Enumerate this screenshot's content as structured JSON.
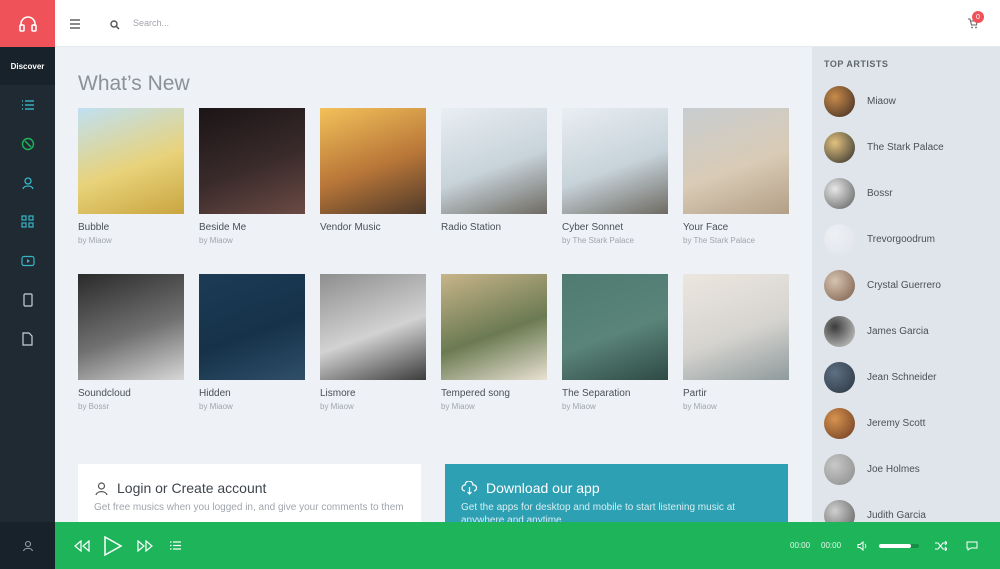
{
  "nav": {
    "discover_label": "Discover"
  },
  "search": {
    "placeholder": "Search..."
  },
  "cart": {
    "count": "0"
  },
  "main": {
    "heading": "What’s New",
    "albums": [
      {
        "title": "Bubble",
        "artist": "by Miaow",
        "palette": [
          "#bfe0f2",
          "#e8d27a",
          "#c9a53f"
        ]
      },
      {
        "title": "Beside Me",
        "artist": "by Miaow",
        "palette": [
          "#1b1416",
          "#3a2b2b",
          "#6b4a44"
        ]
      },
      {
        "title": "Vendor Music",
        "artist": "",
        "palette": [
          "#f3c15a",
          "#b87638",
          "#4f3a2a"
        ]
      },
      {
        "title": "Radio Station",
        "artist": "",
        "palette": [
          "#e9eef2",
          "#c7d3da",
          "#6e6a62"
        ]
      },
      {
        "title": "Cyber Sonnet",
        "artist": "by The Stark Palace",
        "palette": [
          "#e9eef2",
          "#c7d3da",
          "#6e6a62"
        ]
      },
      {
        "title": "Your Face",
        "artist": "by The Stark Palace",
        "palette": [
          "#c8ccd0",
          "#d9cbb6",
          "#b39f86"
        ]
      },
      {
        "title": "Soundcloud",
        "artist": "by Bossr",
        "palette": [
          "#2a2a2a",
          "#707070",
          "#d8d8d8"
        ]
      },
      {
        "title": "Hidden",
        "artist": "by Miaow",
        "palette": [
          "#1c3b55",
          "#16324a",
          "#2f4f68"
        ]
      },
      {
        "title": "Lismore",
        "artist": "by Miaow",
        "palette": [
          "#8e8e8e",
          "#d2d2d2",
          "#3c3c3c"
        ]
      },
      {
        "title": "Tempered song",
        "artist": "by Miaow",
        "palette": [
          "#c8b48a",
          "#6b7a52",
          "#e8e1d2"
        ]
      },
      {
        "title": "The Separation",
        "artist": "by Miaow",
        "palette": [
          "#4f7b70",
          "#5a8479",
          "#2e4a44"
        ]
      },
      {
        "title": "Partir",
        "artist": "by Miaow",
        "palette": [
          "#ece6df",
          "#d6d4d0",
          "#8f9a9c"
        ]
      }
    ]
  },
  "login_panel": {
    "title": "Login or Create account",
    "text": "Get free musics when you logged in, and give your comments to them"
  },
  "download_panel": {
    "title": "Download our app",
    "text": "Get the apps for desktop and mobile to start listening music at anywhere and anytime"
  },
  "sidebar": {
    "heading": "TOP ARTISTS",
    "artists": [
      {
        "name": "Miaow",
        "colors": [
          "#c98b4a",
          "#3a2a22"
        ]
      },
      {
        "name": "The Stark Palace",
        "colors": [
          "#e2c27e",
          "#2b2b2b"
        ]
      },
      {
        "name": "Bossr",
        "colors": [
          "#e7e7e7",
          "#5b5b5b"
        ]
      },
      {
        "name": "Trevorgoodrum",
        "colors": [
          "#eef0f4",
          "#dfe3ea"
        ]
      },
      {
        "name": "Crystal Guerrero",
        "colors": [
          "#d6c3b1",
          "#7a5c48"
        ]
      },
      {
        "name": "James Garcia",
        "colors": [
          "#3b3b3b",
          "#d7d7d7"
        ]
      },
      {
        "name": "Jean Schneider",
        "colors": [
          "#5e7083",
          "#2a3440"
        ]
      },
      {
        "name": "Jeremy Scott",
        "colors": [
          "#d8934f",
          "#6a3a22"
        ]
      },
      {
        "name": "Joe Holmes",
        "colors": [
          "#c8c8c8",
          "#8a8a8a"
        ]
      },
      {
        "name": "Judith Garcia",
        "colors": [
          "#d0d0d0",
          "#5a5a5a"
        ]
      }
    ]
  },
  "player": {
    "current_time": "00:00",
    "total_time": "00:00",
    "volume": 0.8
  },
  "colors": {
    "accent_red": "#f0525a",
    "player_green": "#1eb55a",
    "rail_dark": "#1f2a33",
    "download_teal": "#2ea0b4"
  }
}
